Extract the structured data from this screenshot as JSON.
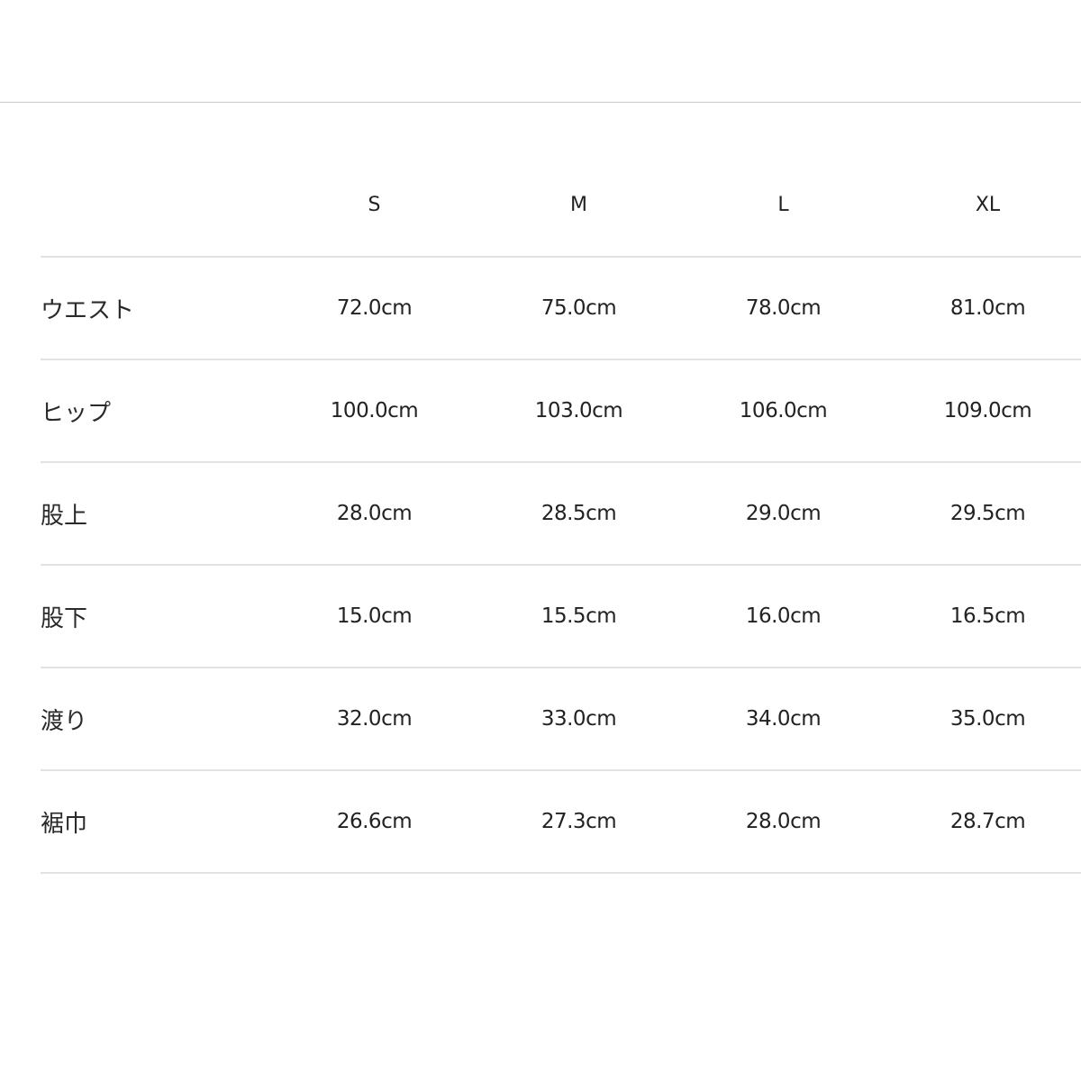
{
  "size_chart": {
    "columns": [
      "S",
      "M",
      "L",
      "XL"
    ],
    "rows": [
      {
        "label": "ウエスト",
        "values": [
          "72.0cm",
          "75.0cm",
          "78.0cm",
          "81.0cm"
        ]
      },
      {
        "label": "ヒップ",
        "values": [
          "100.0cm",
          "103.0cm",
          "106.0cm",
          "109.0cm"
        ]
      },
      {
        "label": "股上",
        "values": [
          "28.0cm",
          "28.5cm",
          "29.0cm",
          "29.5cm"
        ]
      },
      {
        "label": "股下",
        "values": [
          "15.0cm",
          "15.5cm",
          "16.0cm",
          "16.5cm"
        ]
      },
      {
        "label": "渡り",
        "values": [
          "32.0cm",
          "33.0cm",
          "34.0cm",
          "35.0cm"
        ]
      },
      {
        "label": "裾巾",
        "values": [
          "26.6cm",
          "27.3cm",
          "28.0cm",
          "28.7cm"
        ]
      }
    ]
  }
}
